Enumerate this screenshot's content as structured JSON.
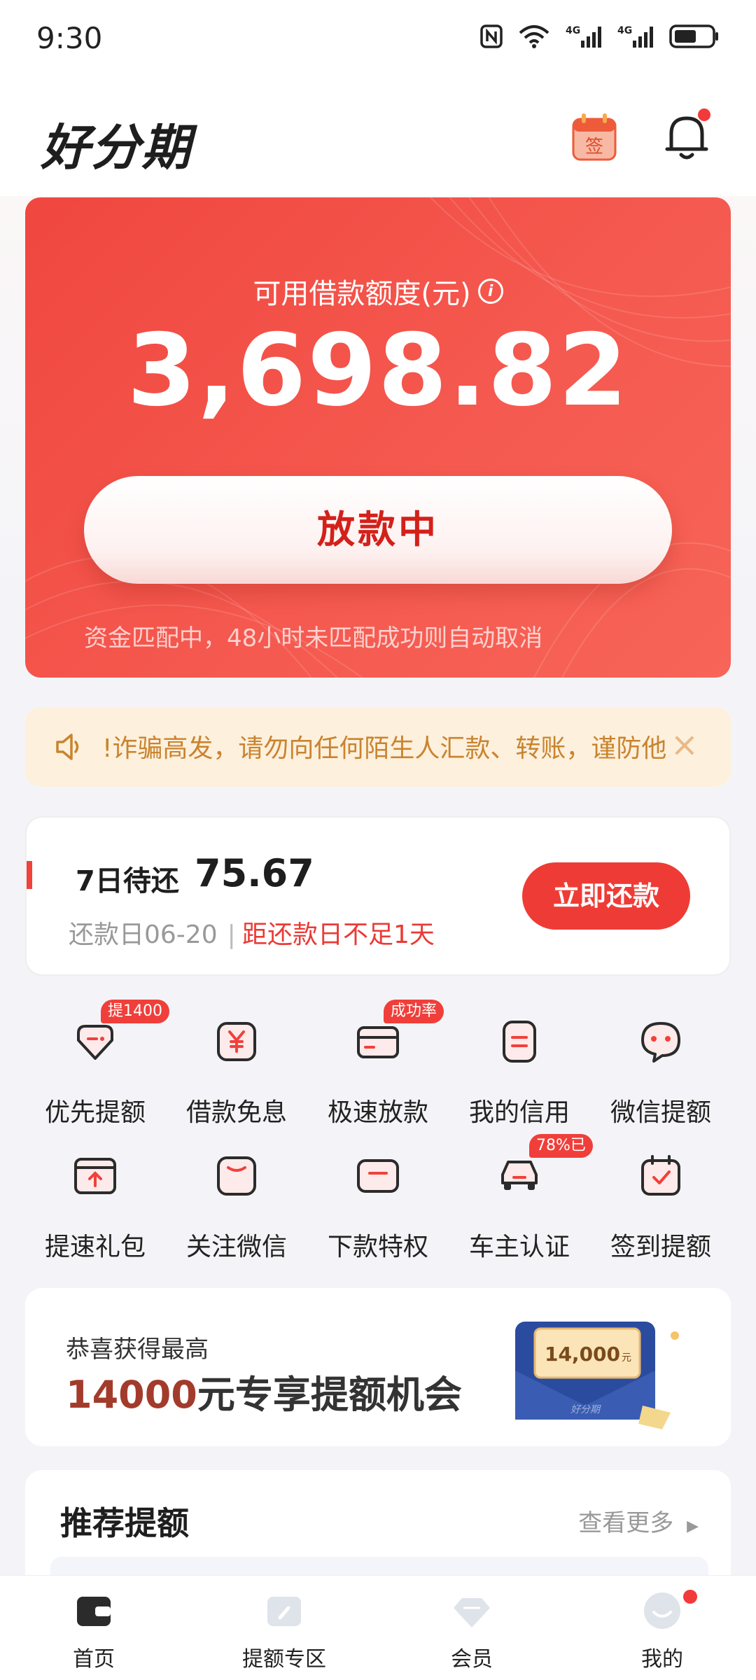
{
  "status_bar": {
    "time": "9:30",
    "icons": [
      "nfc-icon",
      "wifi-icon",
      "signal-4g-icon",
      "signal-4g-icon",
      "battery-icon"
    ],
    "network_label_1": "4G",
    "network_label_2": "4G"
  },
  "header": {
    "app_logo": "好分期",
    "checkin_icon_text": "签",
    "has_notification": true
  },
  "credit_card": {
    "limit_label": "可用借款额度(元)",
    "limit_amount": "3,698.82",
    "loan_button_label": "放款中",
    "match_note": "资金匹配中，48小时未匹配成功则自动取消"
  },
  "notice": {
    "text": "!诈骗高发，请勿向任何陌生人汇款、转账，谨防他"
  },
  "repayment": {
    "label": "7日待还",
    "amount": "75.67",
    "date_text": "还款日06-20",
    "warning_text": "距还款日不足1天",
    "repay_button_label": "立即还款"
  },
  "services": [
    {
      "label": "优先提额",
      "badge": "提1400",
      "icon": "tag-icon"
    },
    {
      "label": "借款免息",
      "badge": "",
      "icon": "yuan-icon"
    },
    {
      "label": "极速放款",
      "badge": "成功率",
      "icon": "card-icon"
    },
    {
      "label": "我的信用",
      "badge": "",
      "icon": "credit-icon"
    },
    {
      "label": "微信提额",
      "badge": "",
      "icon": "chat-bubble-icon"
    },
    {
      "label": "提速礼包",
      "badge": "",
      "icon": "gift-box-icon"
    },
    {
      "label": "关注微信",
      "badge": "",
      "icon": "wechat-follow-icon"
    },
    {
      "label": "下款特权",
      "badge": "",
      "icon": "privilege-icon"
    },
    {
      "label": "车主认证",
      "badge": "78%已",
      "icon": "car-icon"
    },
    {
      "label": "签到提额",
      "badge": "",
      "icon": "calendar-check-icon"
    }
  ],
  "promo": {
    "subtitle": "恭喜获得最高",
    "amount": "14000",
    "title_suffix": "元专享提额机会",
    "envelope_amount": "14,000",
    "envelope_unit": "元",
    "envelope_brand": "好分期"
  },
  "recommend": {
    "title": "推荐提额",
    "more_label": "查看更多"
  },
  "tab_bar": {
    "tabs": [
      {
        "label": "首页",
        "icon": "wallet-icon",
        "active": true
      },
      {
        "label": "提额专区",
        "icon": "boost-icon",
        "active": false
      },
      {
        "label": "会员",
        "icon": "diamond-icon",
        "active": false
      },
      {
        "label": "我的",
        "icon": "profile-icon",
        "active": false,
        "dot": true
      }
    ]
  },
  "colors": {
    "brand_red": "#f0473f",
    "button_red": "#ef3b36",
    "notice_bg": "#fdf0dd",
    "notice_text": "#c9842f"
  }
}
